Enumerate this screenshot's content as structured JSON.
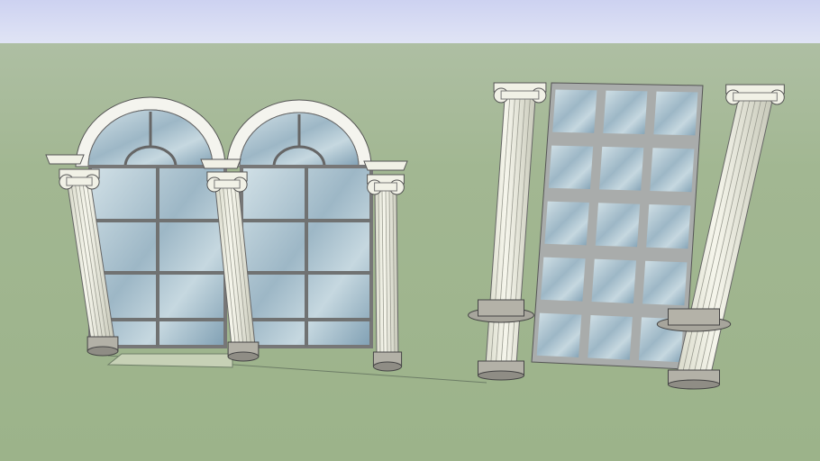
{
  "scene": {
    "colors": {
      "sky_top": "#cdd2f1",
      "sky_horizon": "#dfe3f5",
      "ground_near_horizon": "#aabd9f",
      "ground": "#9db38b",
      "column": "#f1f1e6",
      "column_shade": "#cfd0c2",
      "frame": "#8d8f8f",
      "glass_light": "#c9dbe3",
      "glass_dark": "#7f9fb3",
      "arch": "#f4f4ee"
    },
    "objects": [
      "arched-window-left",
      "arched-window-middle",
      "grid-window-right",
      "ionic-column"
    ]
  }
}
